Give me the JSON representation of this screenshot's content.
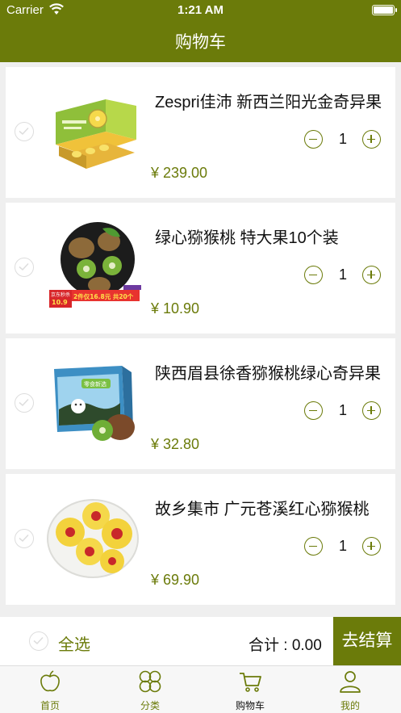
{
  "status_bar": {
    "carrier": "Carrier",
    "time": "1:21 AM"
  },
  "header": {
    "title": "购物车"
  },
  "colors": {
    "accent": "#6b7b0a",
    "background": "#efefef"
  },
  "cart": {
    "items": [
      {
        "name": "Zespri佳沛 新西兰阳光金奇异果",
        "price": "¥ 239.00",
        "quantity": "1",
        "image": "gold-kiwi-gift-box"
      },
      {
        "name": "绿心猕猴桃 特大果10个装",
        "price": "¥ 10.90",
        "quantity": "1",
        "image": "green-kiwi-bowl"
      },
      {
        "name": "陕西眉县徐香猕猴桃绿心奇异果",
        "price": "¥ 32.80",
        "quantity": "1",
        "image": "kiwi-blue-box"
      },
      {
        "name": "故乡集市 广元苍溪红心猕猴桃",
        "price": "¥ 69.90",
        "quantity": "1",
        "image": "red-heart-kiwi-plate"
      }
    ],
    "item_badges": {
      "promo_small": "京东秒杀",
      "promo_price": "10.9",
      "promo_deal": "2件仅16.8元 共20个",
      "box_label": "零食新选"
    }
  },
  "footer": {
    "select_all": "全选",
    "total": "合计 : 0.00",
    "checkout": "去结算"
  },
  "tabbar": {
    "tabs": [
      {
        "label": "首页",
        "icon": "apple-icon"
      },
      {
        "label": "分类",
        "icon": "clover-icon"
      },
      {
        "label": "购物车",
        "icon": "cart-icon"
      },
      {
        "label": "我的",
        "icon": "user-icon"
      }
    ],
    "active": "购物车"
  }
}
